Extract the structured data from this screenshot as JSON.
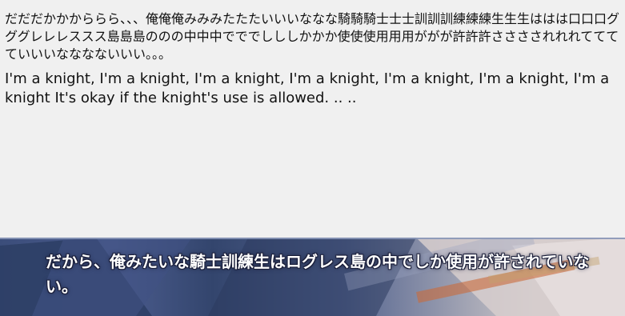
{
  "translation_panel": {
    "japanese_line": "だだだかかかららら、、、俺俺俺みみみたたたいいいななな騎騎騎士士士訓訓訓練練練生生生ははは口口口グググレレレススス島島島ののの中中中でででしししかかか使使使用用用ががが許許許さささされれれてててていいいなななないいい。。。",
    "english_line": "I'm a knight, I'm a knight, I'm a knight, I'm a knight, I'm a knight, I'm a knight, I'm a knight It's okay if the knight's use is allowed. .. .."
  },
  "game_window": {
    "dialogue_text": "だから、俺みたいな騎士訓練生はログレス島の中でしか使用が許されていない。"
  }
}
